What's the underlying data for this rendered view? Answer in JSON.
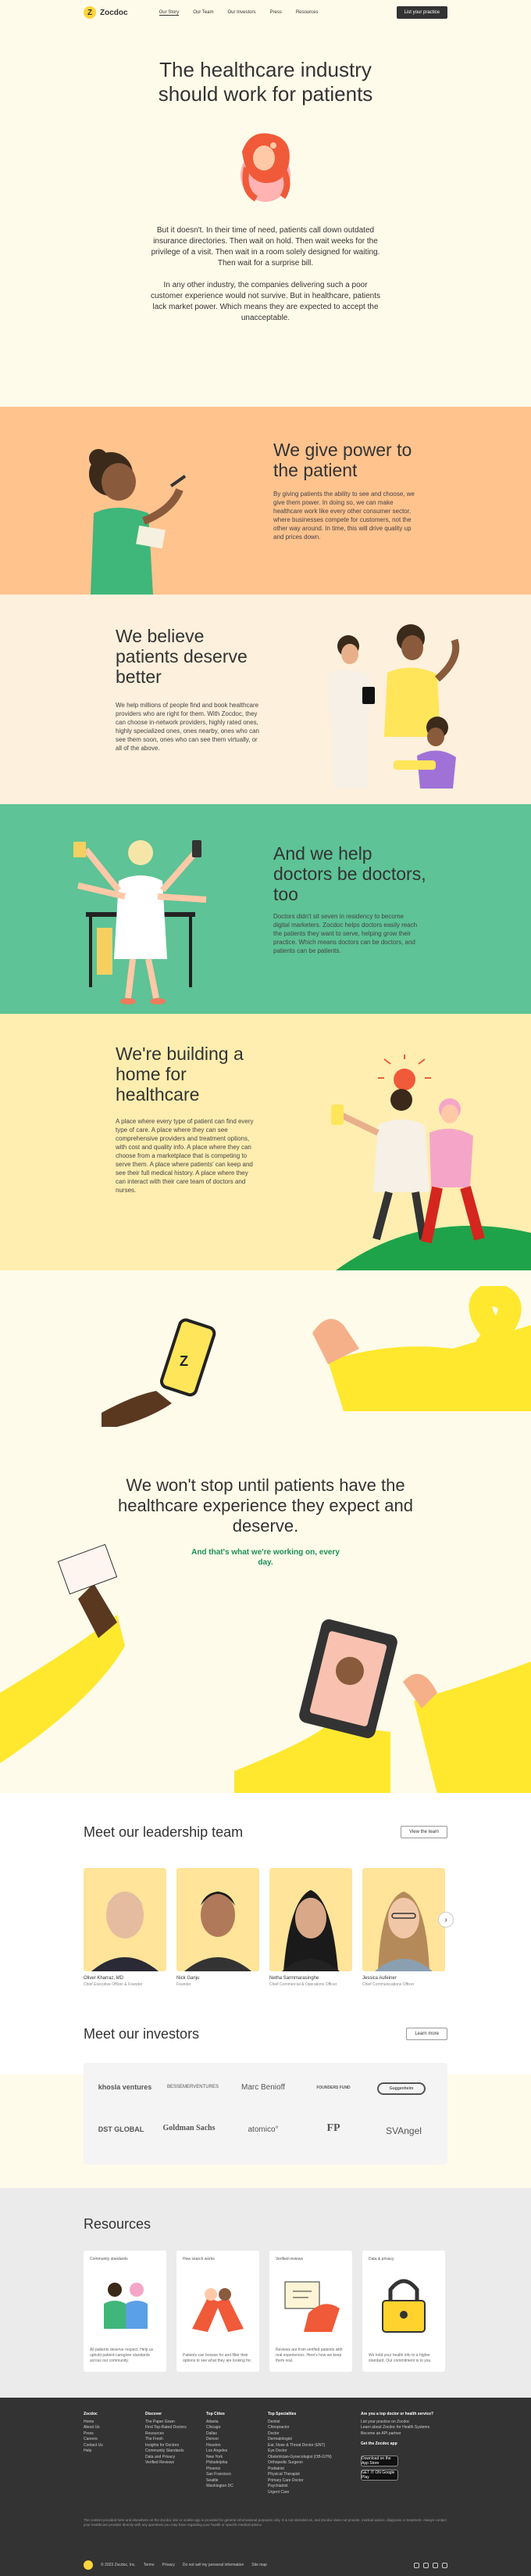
{
  "nav": {
    "logo_mark": "Z",
    "logo_text": "Zocdoc",
    "links": [
      "Our Story",
      "Our Team",
      "Our Investors",
      "Press",
      "Resources"
    ],
    "cta": "List your practice"
  },
  "hero": {
    "title": "The healthcare industry should work for patients",
    "paragraphs": [
      "But it doesn't. In their time of need, patients call down outdated insurance directories. Then wait on hold. Then wait weeks for the privilege of a visit. Then wait in a room solely designed for waiting. Then wait for a surprise bill.",
      "In any other industry, the companies delivering such a poor customer experience would not survive. But in healthcare, patients lack market power. Which means they are expected to accept the unacceptable."
    ]
  },
  "power": {
    "title": "We give power to the patient",
    "body": "By giving patients the ability to see and choose, we give them power. In doing so, we can make healthcare work like every other consumer sector, where businesses compete for customers, not the other way around. In time, this will drive quality up and prices down."
  },
  "better": {
    "title": "We believe patients deserve better",
    "body": "We help millions of people find and book healthcare providers who are right for them. With Zocdoc, they can choose in-network providers, highly rated ones, highly specialized ones, ones nearby, ones who can see them soon, ones who can see them virtually, or all of the above."
  },
  "doctors": {
    "title": "And we help doctors be doctors, too",
    "body": "Doctors didn't sit seven in residency to become digital marketers. Zocdoc helps doctors easily reach the patients they want to serve, helping grow their practice. Which means doctors can be doctors, and patients can be patients."
  },
  "building": {
    "title": "We're building a home for healthcare",
    "body": "A place where every type of patient can find every type of care. A place where they can see comprehensive providers and treatment options, with cost and quality info. A place where they can choose from a marketplace that is competing to serve them. A place where patients' can keep and see their full medical history. A place where they can interact with their care team of doctors and nurses."
  },
  "patients": {
    "quote": "We won't stop until patients have the healthcare experience they expect and deserve.",
    "sub": "And that's what we're working on, every day."
  },
  "leadership": {
    "title": "Meet our leadership team",
    "button": "View the team",
    "next": "›",
    "people": [
      {
        "name": "Oliver Kharraz, MD",
        "role": "Chief Executive Officer & Founder"
      },
      {
        "name": "Nick Ganju",
        "role": "Founder"
      },
      {
        "name": "Netha Sarmmarasinghe",
        "role": "Chief Commercial & Operations Officer"
      },
      {
        "name": "Jessica Aufeiner",
        "role": "Chief Communications Officer"
      }
    ]
  },
  "investors": {
    "title": "Meet our investors",
    "button": "Learn more",
    "logos": [
      "khosla ventures",
      "BESSEMERVENTURES",
      "Marc Benioff",
      "FOUNDERS FUND",
      "Guggenheim",
      "DST GLOBAL",
      "Goldman Sachs",
      "atomico°",
      "FP",
      "SVAngel"
    ]
  },
  "resources": {
    "title": "Resources",
    "cards": [
      {
        "tag": "Community standards",
        "desc": "All patients deserve respect. Help us uphold patient-caregiver standards across our community."
      },
      {
        "tag": "How search works",
        "desc": "Patients can browse for and filter their options to see what they are looking for."
      },
      {
        "tag": "Verified reviews",
        "desc": "Reviews are from verified patients with real experiences. Here's how we keep them real."
      },
      {
        "tag": "Data & privacy",
        "desc": "We hold your health info to a higher standard. Our commitment is to you."
      }
    ]
  },
  "footer": {
    "columns": [
      {
        "heading": "Zocdoc",
        "items": [
          "Home",
          "About Us",
          "Press",
          "Careers",
          "Contact Us",
          "Help"
        ]
      },
      {
        "heading": "Discover",
        "items": [
          "The Paper Gown",
          "Find Top-Rated Doctors",
          "Resources",
          "The Fresh",
          "Insights for Doctors",
          "Community Standards",
          "Data and Privacy",
          "Verified Reviews"
        ]
      },
      {
        "heading": "Top Cities",
        "items": [
          "Atlanta",
          "Chicago",
          "Dallas",
          "Denver",
          "Houston",
          "Los Angeles",
          "New York",
          "Philadelphia",
          "Phoenix",
          "San Francisco",
          "Seattle",
          "Washington DC"
        ]
      },
      {
        "heading": "Top Specialties",
        "items": [
          "Dentist",
          "Chiropractor",
          "Doctor",
          "Dermatologist",
          "Ear, Nose & Throat Doctor (ENT)",
          "Eye Doctor",
          "Obstetrician-Gynecologist (OB-GYN)",
          "Orthopedic Surgeon",
          "Podiatrist",
          "Physical Therapist",
          "Primary Care Doctor",
          "Psychiatrist",
          "Urgent Care"
        ]
      },
      {
        "heading": "Are you a top doctor or health service?",
        "items": [
          "List your practice on Zocdoc",
          "Learn about Zocdoc for Health Systems",
          "Become an API partner",
          "",
          "Get the Zocdoc app"
        ]
      }
    ],
    "app_store": "Download on the App Store",
    "google_play": "GET IT ON Google Play",
    "note": "The content provided here and elsewhere on the Zocdoc site or mobile app is provided for general informational purposes only. It is not intended as, and Zocdoc does not provide, medical advice, diagnosis or treatment. Always contact your healthcare provider directly with any questions you may have regarding your health or specific medical advice.",
    "copyright": "© 2023 Zocdoc, Inc.",
    "links": [
      "Terms",
      "Privacy",
      "Do not sell my personal information",
      "Site map"
    ]
  }
}
